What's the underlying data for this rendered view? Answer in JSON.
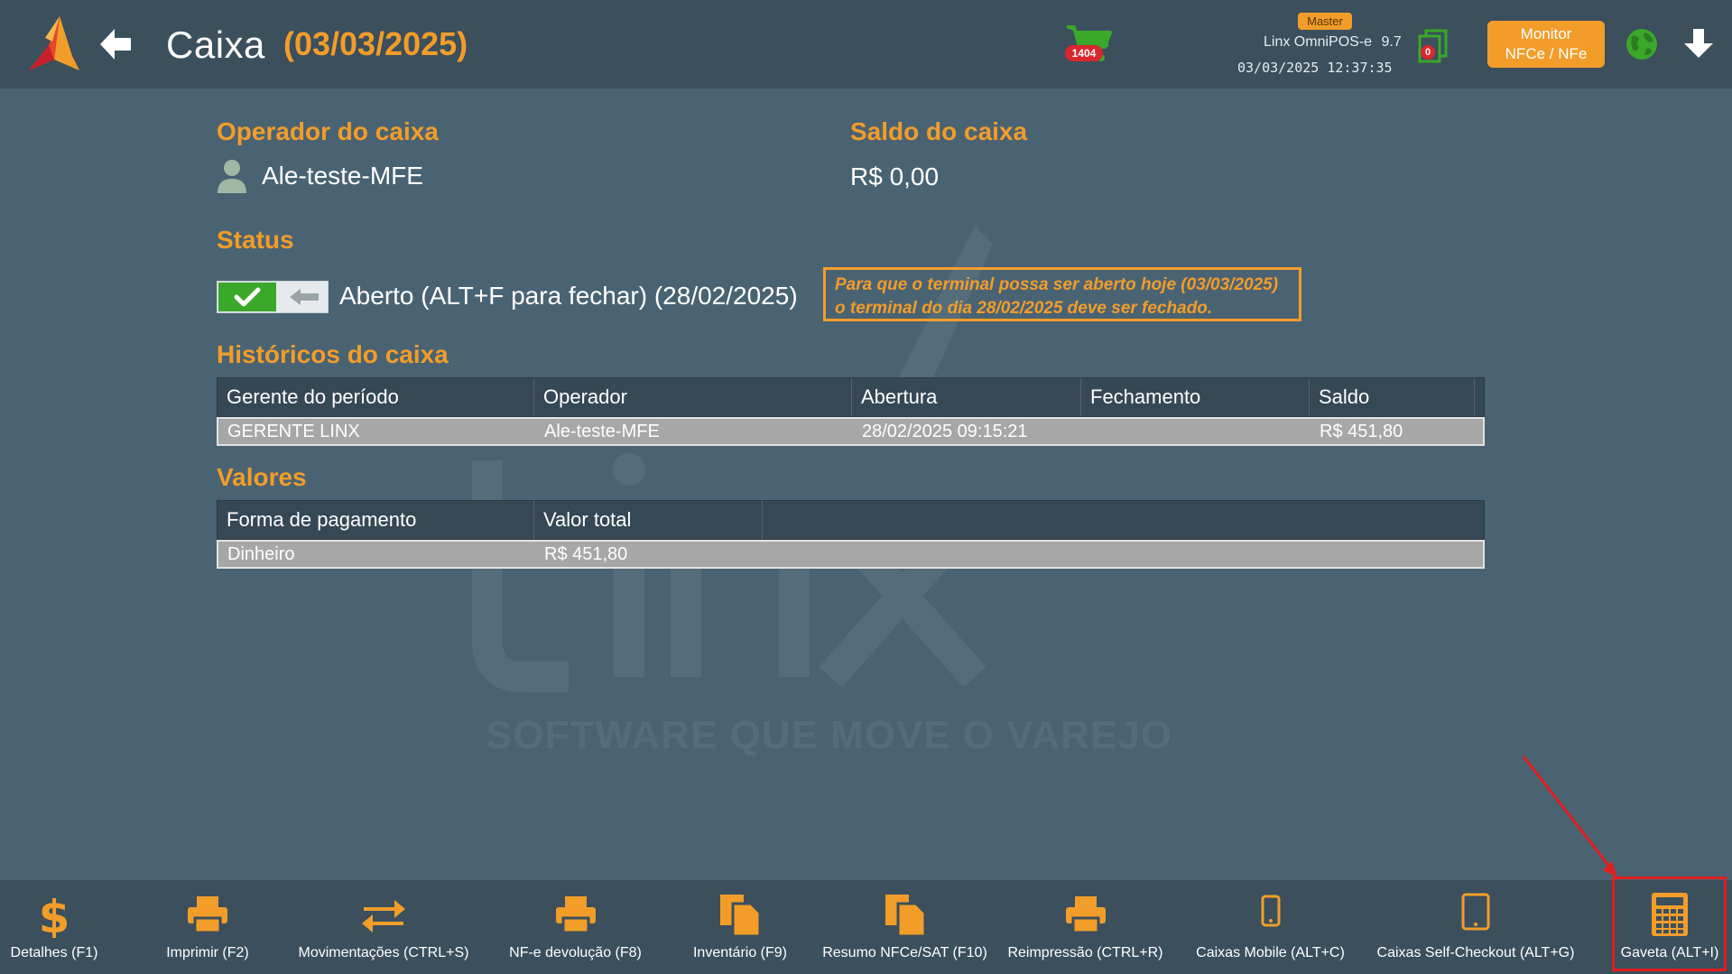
{
  "header": {
    "title": "Caixa",
    "date": "(03/03/2025)",
    "cart_count": "1404",
    "master_label": "Master",
    "product_name": "Linx OmniPOS-e",
    "product_version": "9.7",
    "datetime": "03/03/2025 12:37:35",
    "docs_count": "0",
    "monitor_button": {
      "line1": "Monitor",
      "line2": "NFCe / NFe"
    }
  },
  "operator": {
    "label": "Operador do caixa",
    "name": "Ale-teste-MFE"
  },
  "saldo": {
    "label": "Saldo do caixa",
    "value": "R$ 0,00"
  },
  "status": {
    "label": "Status",
    "text": "Aberto (ALT+F para fechar) (28/02/2025)",
    "warning_line1": "Para que o terminal possa ser aberto hoje (03/03/2025)",
    "warning_line2": "o terminal do dia 28/02/2025 deve ser fechado."
  },
  "historicos": {
    "label": "Históricos do caixa",
    "columns": [
      "Gerente do período",
      "Operador",
      "Abertura",
      "Fechamento",
      "Saldo"
    ],
    "rows": [
      [
        "GERENTE LINX",
        "Ale-teste-MFE",
        "28/02/2025 09:15:21",
        "",
        "R$ 451,80"
      ]
    ]
  },
  "valores": {
    "label": "Valores",
    "columns": [
      "Forma de pagamento",
      "Valor total"
    ],
    "rows": [
      [
        "Dinheiro",
        "R$ 451,80"
      ]
    ]
  },
  "watermark": "SOFTWARE QUE MOVE O VAREJO",
  "toolbar": [
    {
      "label": "Detalhes (F1)",
      "icon": "dollar-icon"
    },
    {
      "label": "Imprimir (F2)",
      "icon": "printer-icon"
    },
    {
      "label": "Movimentações (CTRL+S)",
      "icon": "transfer-arrows-icon"
    },
    {
      "label": "NF-e devolução (F8)",
      "icon": "printer-icon"
    },
    {
      "label": "Inventário (F9)",
      "icon": "documents-icon"
    },
    {
      "label": "Resumo NFCe/SAT (F10)",
      "icon": "documents-icon"
    },
    {
      "label": "Reimpressão (CTRL+R)",
      "icon": "printer-icon"
    },
    {
      "label": "Caixas Mobile (ALT+C)",
      "icon": "mobile-icon"
    },
    {
      "label": "Caixas Self-Checkout (ALT+G)",
      "icon": "tablet-icon"
    },
    {
      "label": "Gaveta (ALT+I)",
      "icon": "calculator-icon"
    }
  ],
  "colors": {
    "accent": "#f29d2a",
    "background": "#4a6372",
    "header": "#3b4f5c",
    "status_on": "#3aa829",
    "highlight": "#e01e1e"
  }
}
